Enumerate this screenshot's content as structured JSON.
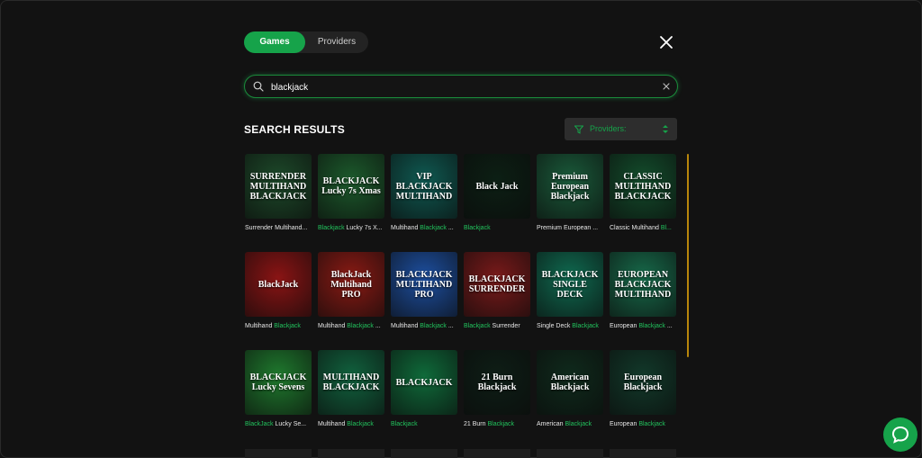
{
  "tabs": [
    {
      "label": "Games",
      "active": true
    },
    {
      "label": "Providers",
      "active": false
    }
  ],
  "search": {
    "value": "blackjack",
    "placeholder": "Search"
  },
  "results_title": "SEARCH RESULTS",
  "providers_filter": {
    "label": "Providers:"
  },
  "accent_color": "#16a34a",
  "games": [
    {
      "thumb": "SURRENDER MULTIHAND BLACKJACK",
      "bg": "#1d4a2a",
      "pre": "Surrender Multihand...",
      "hl": "",
      "post": ""
    },
    {
      "thumb": "BLACKJACK Lucky 7s Xmas",
      "bg": "#1c5a2c",
      "pre": "",
      "hl": "Blackjack",
      "post": " Lucky 7s X..."
    },
    {
      "thumb": "VIP BLACKJACK MULTIHAND",
      "bg": "#0f5a52",
      "pre": "Multihand ",
      "hl": "Blackjack",
      "post": " ..."
    },
    {
      "thumb": "Black Jack",
      "bg": "#0c1f14",
      "pre": "",
      "hl": "Blackjack",
      "post": ""
    },
    {
      "thumb": "Premium European Blackjack",
      "bg": "#1a5a3a",
      "pre": "Premium European ...",
      "hl": "",
      "post": ""
    },
    {
      "thumb": "CLASSIC MULTIHAND BLACKJACK",
      "bg": "#134d2c",
      "pre": "Classic Multihand ",
      "hl": "Bl...",
      "post": ""
    },
    {
      "thumb": "BlackJack",
      "bg": "#8a1414",
      "pre": "Multihand ",
      "hl": "Blackjack",
      "post": ""
    },
    {
      "thumb": "BlackJack Multihand PRO",
      "bg": "#8a1a14",
      "pre": "Multihand ",
      "hl": "Blackjack",
      "post": " ..."
    },
    {
      "thumb": "BLACKJACK MULTIHAND PRO",
      "bg": "#1d4fa0",
      "pre": "Multihand ",
      "hl": "Blackjack",
      "post": " ..."
    },
    {
      "thumb": "BLACKJACK SURRENDER",
      "bg": "#7a1a1a",
      "pre": "",
      "hl": "Blackjack",
      "post": " Surrender"
    },
    {
      "thumb": "BLACKJACK SINGLE DECK",
      "bg": "#0f6a50",
      "pre": "Single Deck ",
      "hl": "Blackjack",
      "post": ""
    },
    {
      "thumb": "EUROPEAN BLACKJACK MULTIHAND",
      "bg": "#176a4a",
      "pre": "European ",
      "hl": "Blackjack",
      "post": " ..."
    },
    {
      "thumb": "BLACKJACK Lucky Sevens",
      "bg": "#1f7a2e",
      "pre": "",
      "hl": "BlackJack",
      "post": " Lucky Se..."
    },
    {
      "thumb": "MULTIHAND BLACKJACK",
      "bg": "#11623e",
      "pre": "Multihand ",
      "hl": "Blackjack",
      "post": ""
    },
    {
      "thumb": "BLACKJACK",
      "bg": "#0f6a3a",
      "pre": "",
      "hl": "Blackjack",
      "post": ""
    },
    {
      "thumb": "21 Burn Blackjack",
      "bg": "#0e1e16",
      "pre": "21 Burn ",
      "hl": "Blackjack",
      "post": ""
    },
    {
      "thumb": "American Blackjack",
      "bg": "#0f2a1c",
      "pre": "American ",
      "hl": "Blackjack",
      "post": ""
    },
    {
      "thumb": "European Blackjack",
      "bg": "#12392a",
      "pre": "European ",
      "hl": "Blackjack",
      "post": ""
    }
  ]
}
